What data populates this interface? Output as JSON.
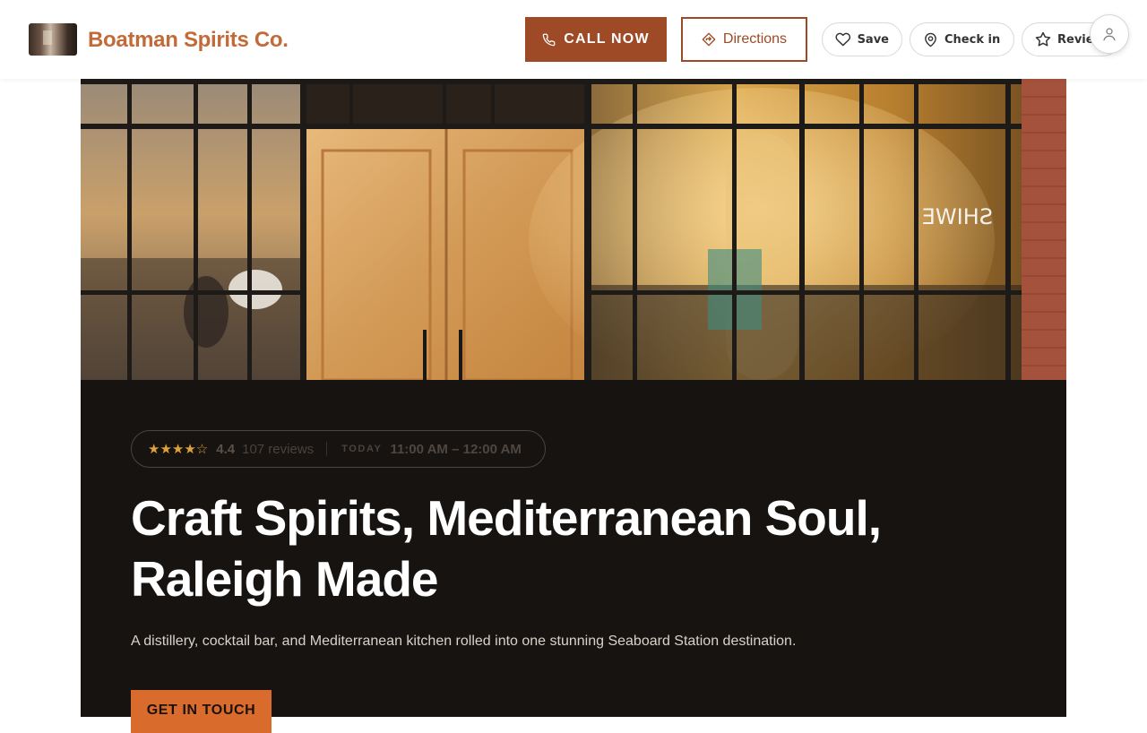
{
  "header": {
    "brand_name": "Boatman Spirits Co.",
    "call_label": "CALL NOW",
    "directions_label": "Directions",
    "save_label": "Save",
    "checkin_label": "Check in",
    "review_label": "Review"
  },
  "hero": {
    "window_text": "SHIWE"
  },
  "info": {
    "stars": "★★★★☆",
    "rating": "4.4",
    "reviews": "107 reviews",
    "today_label": "TODAY",
    "hours": "11:00 AM – 12:00 AM"
  },
  "main": {
    "headline": "Craft Spirits, Mediterranean Soul, Raleigh Made",
    "subline": "A distillery, cocktail bar, and Mediterranean kitchen rolled into one stunning Seaboard Station destination.",
    "cta_label": "GET IN TOUCH"
  },
  "colors": {
    "accent": "#9f4a26",
    "brand": "#c26a38",
    "cta": "#d96c2c",
    "panel": "#171311",
    "star": "#e0a33a"
  },
  "icons": [
    "phone-icon",
    "directions-icon",
    "heart-icon",
    "location-pin-icon",
    "star-icon",
    "user-icon"
  ]
}
